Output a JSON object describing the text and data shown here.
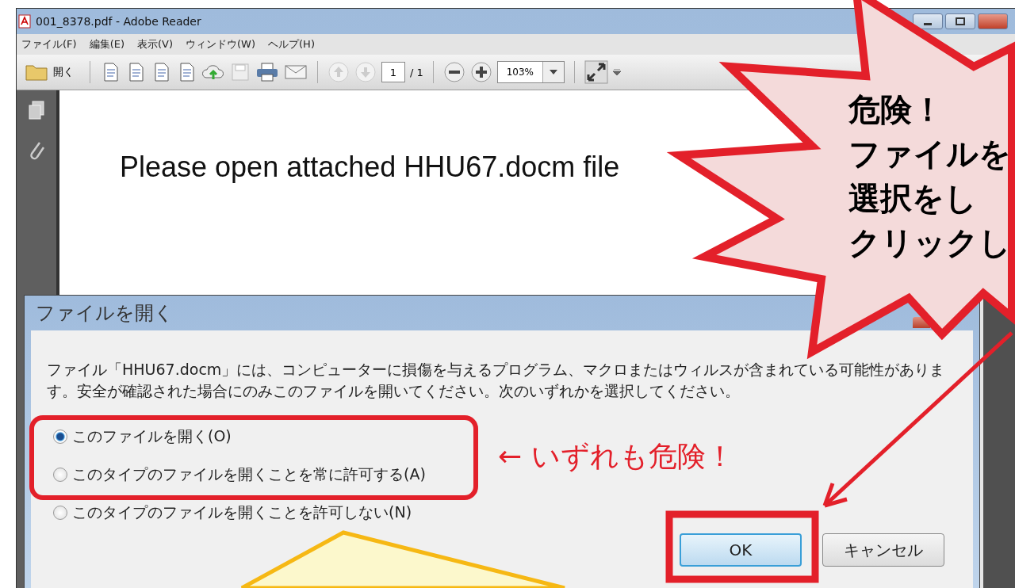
{
  "window": {
    "title": "001_8378.pdf - Adobe Reader"
  },
  "menu": [
    "ファイル(F)",
    "編集(E)",
    "表示(V)",
    "ウィンドウ(W)",
    "ヘルプ(H)"
  ],
  "toolbar": {
    "open_label": "開く",
    "page": "1",
    "page_total": "/ 1",
    "zoom": "103%"
  },
  "document": {
    "text": "Please open attached HHU67.docm file"
  },
  "dialog": {
    "title": "ファイルを開く",
    "message": "ファイル「HHU67.docm」には、コンピューターに損傷を与えるプログラム、マクロまたはウィルスが含まれている可能性があります。安全が確認された場合にのみこのファイルを開いてください。次のいずれかを選択してください。",
    "options": [
      {
        "label": "このファイルを開く(O)",
        "selected": true
      },
      {
        "label": "このタイプのファイルを開くことを常に許可する(A)",
        "selected": false
      },
      {
        "label": "このタイプのファイルを開くことを許可しない(N)",
        "selected": false
      }
    ],
    "buttons": [
      {
        "label": "OK",
        "default": true
      },
      {
        "label": "キャンセル",
        "default": false
      }
    ]
  },
  "annotations": {
    "warning_lines": [
      "危険！",
      "ファイルを",
      "選択をし",
      "クリックし"
    ],
    "side_note": "← いずれも危険！"
  }
}
